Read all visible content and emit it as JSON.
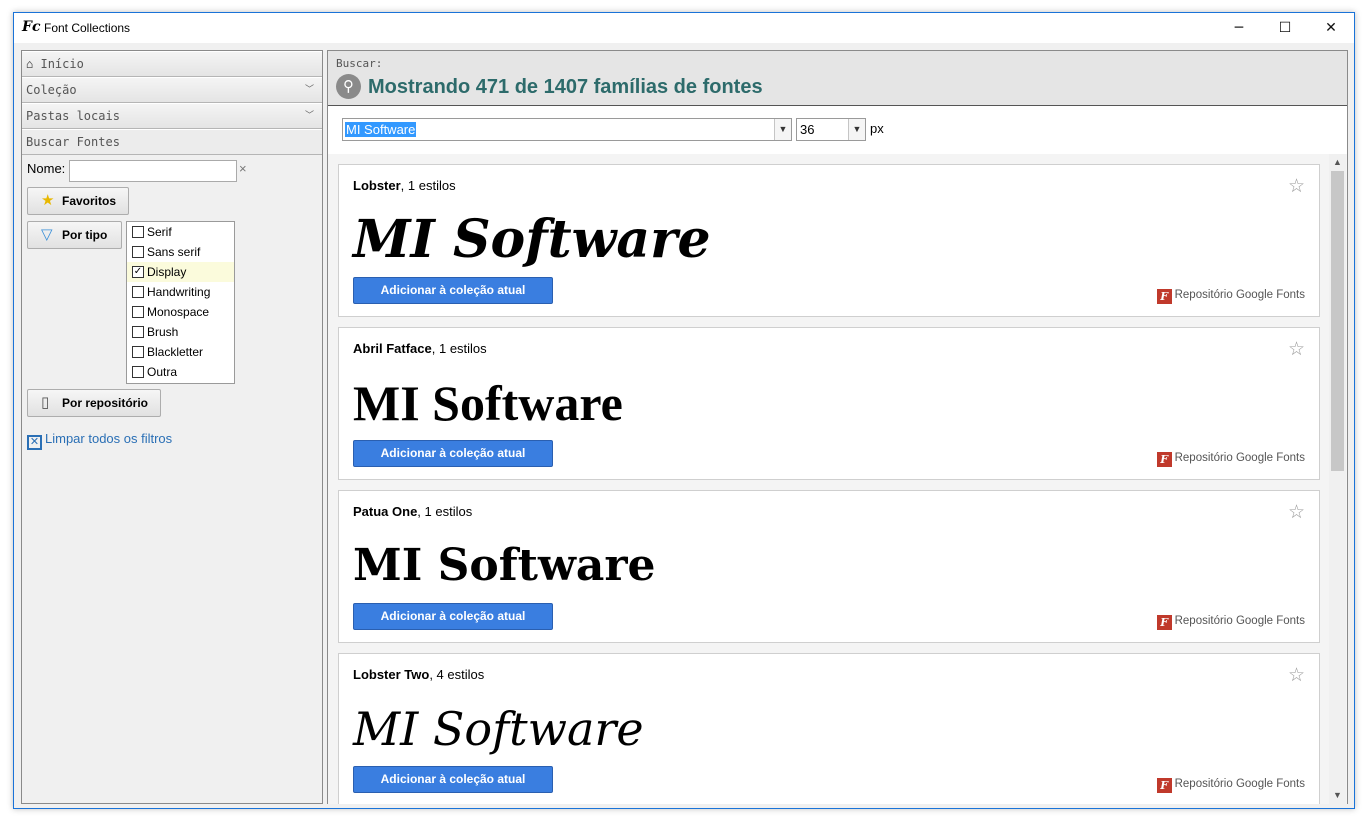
{
  "window": {
    "title": "Font Collections",
    "app_icon_glyph": "Fc",
    "controls": {
      "minimize": "─",
      "maximize": "☐",
      "close": "✕"
    }
  },
  "sidebar": {
    "sections": [
      {
        "label": "Início",
        "icon": "home-icon",
        "glyph": "⌂"
      },
      {
        "label": "Coleção",
        "chevron": "﹀"
      },
      {
        "label": "Pastas locais",
        "chevron": "﹀"
      },
      {
        "label": "Buscar Fontes"
      }
    ],
    "name_label": "Nome:",
    "name_value": "",
    "clear_glyph": "×",
    "favorites_label": "Favoritos",
    "by_type_label": "Por tipo",
    "types": [
      {
        "label": "Serif",
        "checked": false
      },
      {
        "label": "Sans serif",
        "checked": false
      },
      {
        "label": "Display",
        "checked": true
      },
      {
        "label": "Handwriting",
        "checked": false
      },
      {
        "label": "Monospace",
        "checked": false
      },
      {
        "label": "Brush",
        "checked": false
      },
      {
        "label": "Blackletter",
        "checked": false
      },
      {
        "label": "Outra",
        "checked": false
      }
    ],
    "by_repo_label": "Por repositório",
    "clear_all_label": "Limpar todos os filtros"
  },
  "search": {
    "label": "Buscar:",
    "title": "Mostrando 471 de 1407 famílias de fontes",
    "sample_text": "MI Software",
    "size_value": "36",
    "size_unit": "px"
  },
  "cards": [
    {
      "family": "Lobster",
      "styles": ", 1 estilos",
      "sample": "MI Software",
      "button": "Adicionar à coleção atual",
      "repo": "Repositório Google Fonts"
    },
    {
      "family": "Abril Fatface",
      "styles": ", 1 estilos",
      "sample": "MI Software",
      "button": "Adicionar à coleção atual",
      "repo": "Repositório Google Fonts"
    },
    {
      "family": "Patua One",
      "styles": ", 1 estilos",
      "sample": "MI Software",
      "button": "Adicionar à coleção atual",
      "repo": "Repositório Google Fonts"
    },
    {
      "family": "Lobster Two",
      "styles": ", 4 estilos",
      "sample": "MI Software",
      "button": "Adicionar à coleção atual",
      "repo": "Repositório Google Fonts"
    }
  ],
  "colors": {
    "accent_button": "#3a7ee0",
    "title_teal": "#2d6b6b",
    "repo_icon": "#c0392b",
    "link_blue": "#2a6fb5"
  }
}
